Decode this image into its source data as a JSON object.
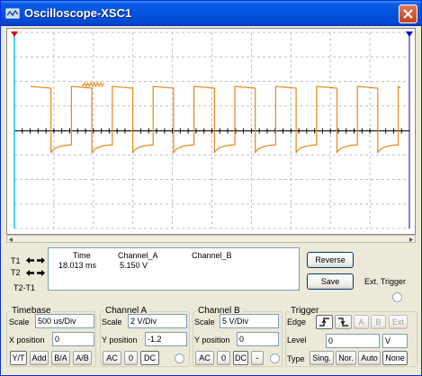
{
  "window": {
    "title": "Oscilloscope-XSC1"
  },
  "colors": {
    "trace": "#E8871A",
    "cursor_t1": "#00C8E8",
    "cursor_t2": "#0000C8",
    "title_gradient": "#0453DE"
  },
  "readout": {
    "t1_label": "T1",
    "t2_label": "T2",
    "t2t1_label": "T2-T1",
    "headers": {
      "time": "Time",
      "channel_a": "Channel_A",
      "channel_b": "Channel_B"
    },
    "row1": {
      "time": "18.013 ms",
      "channel_a": "5.150 V",
      "channel_b": ""
    }
  },
  "buttons": {
    "reverse": "Reverse",
    "save": "Save",
    "ext_trigger": "Ext. Trigger"
  },
  "timebase": {
    "title": "Timebase",
    "scale_label": "Scale",
    "scale_value": "500 us/Div",
    "xpos_label": "X position",
    "xpos_value": "0",
    "modes": [
      "Y/T",
      "Add",
      "B/A",
      "A/B"
    ]
  },
  "channel_a": {
    "title": "Channel A",
    "scale_label": "Scale",
    "scale_value": "2  V/Div",
    "ypos_label": "Y position",
    "ypos_value": "-1.2",
    "coupling": [
      "AC",
      "0",
      "DC"
    ]
  },
  "channel_b": {
    "title": "Channel B",
    "scale_label": "Scale",
    "scale_value": "5  V/Div",
    "ypos_label": "Y position",
    "ypos_value": "0",
    "coupling": [
      "AC",
      "0",
      "DC",
      "-"
    ]
  },
  "trigger": {
    "title": "Trigger",
    "edge_label": "Edge",
    "edge_buttons": [
      "A",
      "B",
      "Ext"
    ],
    "level_label": "Level",
    "level_value": "0",
    "level_unit": "V",
    "type_label": "Type",
    "types": [
      "Sing.",
      "Nor.",
      "Auto",
      "None"
    ]
  }
}
